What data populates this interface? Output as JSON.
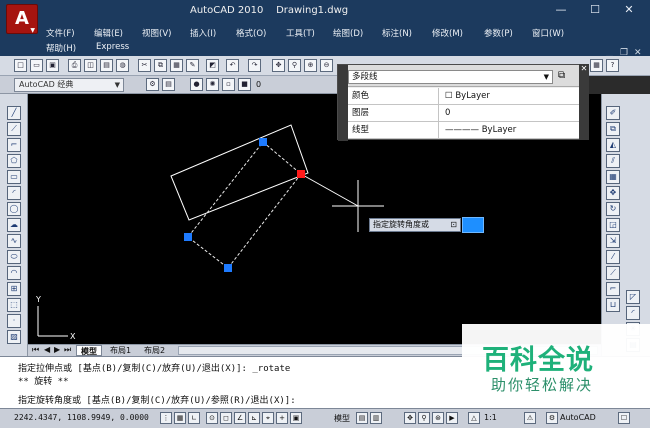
{
  "window": {
    "app_title": "AutoCAD 2010",
    "doc_title": "Drawing1.dwg",
    "minimize_glyph": "—",
    "restore_glyph": "☐",
    "close_glyph": "✕"
  },
  "menu": {
    "items": [
      "文件(F)",
      "编辑(E)",
      "视图(V)",
      "插入(I)",
      "格式(O)",
      "工具(T)",
      "绘图(D)",
      "标注(N)",
      "修改(M)",
      "参数(P)",
      "窗口(W)"
    ],
    "row2": [
      "帮助(H)",
      "Express"
    ]
  },
  "toolbar": {
    "workspace": "AutoCAD 经典",
    "layer_value": "0"
  },
  "properties": {
    "object_type": "多段线",
    "rows": [
      {
        "label": "颜色",
        "value": "ByLayer"
      },
      {
        "label": "图层",
        "value": "0"
      },
      {
        "label": "线型",
        "value": "ByLayer"
      }
    ]
  },
  "drawing": {
    "rotate_prompt": "指定旋转角度或",
    "ucs_x": "X",
    "ucs_y": "Y",
    "colors": {
      "background": "#000000",
      "grip": "#1e7bff",
      "hot_grip": "#ff1a1a",
      "line": "#ffffff"
    }
  },
  "tabs": {
    "model": "模型",
    "layout1": "布局1",
    "layout2": "布局2"
  },
  "command": {
    "line1": "指定拉伸点或 [基点(B)/复制(C)/放弃(U)/退出(X)]: _rotate",
    "line2": "** 旋转 **",
    "line3": "指定旋转角度或 [基点(B)/复制(C)/放弃(U)/参照(R)/退出(X)]:"
  },
  "status": {
    "coords": "2242.4347, 1108.9949, 0.0000",
    "model_label": "模型",
    "scale": "1:1",
    "workspace_short": "AutoCAD"
  },
  "watermark": {
    "line1": "百科全说",
    "line2": "助你轻松解决"
  }
}
